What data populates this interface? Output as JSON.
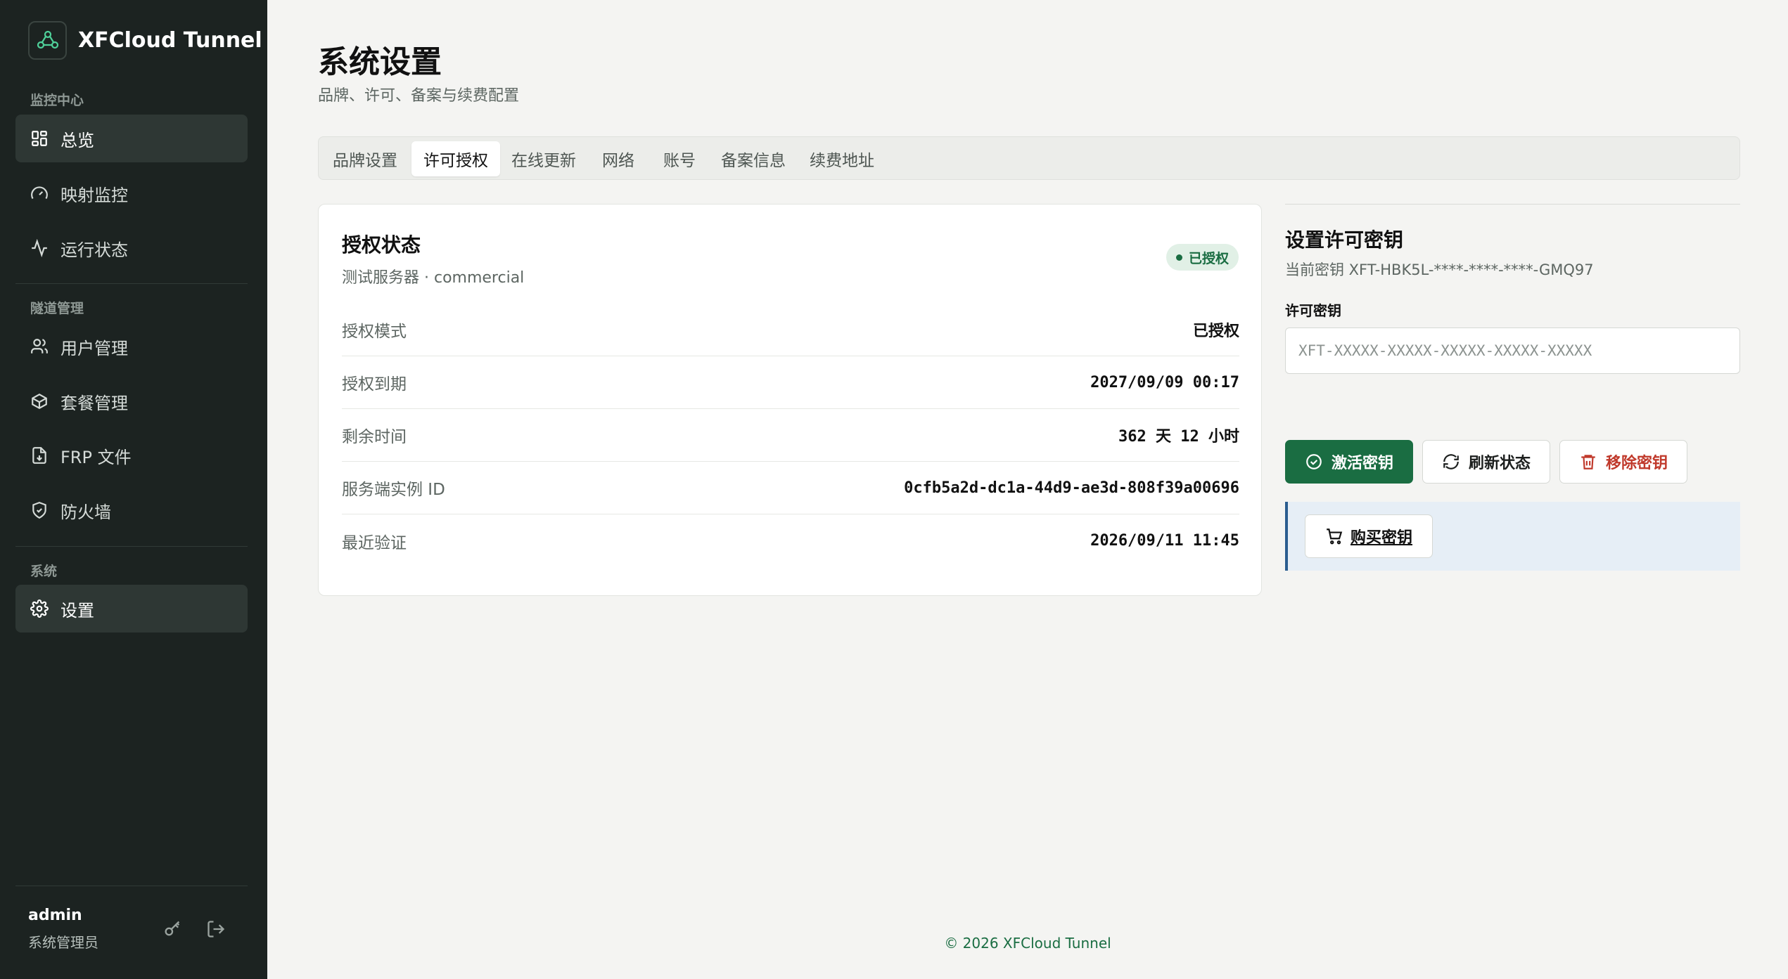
{
  "app": {
    "name": "XFCloud Tunnel"
  },
  "sidebar": {
    "sections": [
      {
        "title": "监控中心",
        "items": [
          {
            "label": "总览",
            "icon": "grid-icon",
            "active": true
          },
          {
            "label": "映射监控",
            "icon": "gauge-icon"
          },
          {
            "label": "运行状态",
            "icon": "activity-icon"
          }
        ]
      },
      {
        "title": "隧道管理",
        "items": [
          {
            "label": "用户管理",
            "icon": "users-icon"
          },
          {
            "label": "套餐管理",
            "icon": "package-icon"
          },
          {
            "label": "FRP 文件",
            "icon": "file-download-icon"
          },
          {
            "label": "防火墙",
            "icon": "shield-icon"
          }
        ]
      },
      {
        "title": "系统",
        "items": [
          {
            "label": "设置",
            "icon": "gear-icon",
            "active": true
          }
        ]
      }
    ],
    "user": {
      "name": "admin",
      "role": "系统管理员"
    }
  },
  "page": {
    "title": "系统设置",
    "subtitle": "品牌、许可、备案与续费配置"
  },
  "tabs": [
    "品牌设置",
    "许可授权",
    "在线更新",
    "网络",
    "账号",
    "备案信息",
    "续费地址"
  ],
  "active_tab": "许可授权",
  "license": {
    "title": "授权状态",
    "subtitle": "测试服务器 · commercial",
    "badge": "已授权",
    "rows": [
      {
        "key": "授权模式",
        "value": "已授权"
      },
      {
        "key": "授权到期",
        "value": "2027/09/09 00:17"
      },
      {
        "key": "剩余时间",
        "value": "362 天 12 小时"
      },
      {
        "key": "服务端实例 ID",
        "value": "0cfb5a2d-dc1a-44d9-ae3d-808f39a00696"
      },
      {
        "key": "最近验证",
        "value": "2026/09/11 11:45"
      }
    ]
  },
  "key_panel": {
    "title": "设置许可密钥",
    "current": "当前密钥 XFT-HBK5L-****-****-****-GMQ97",
    "field_label": "许可密钥",
    "placeholder": "XFT-XXXXX-XXXXX-XXXXX-XXXXX-XXXXX",
    "value": "",
    "activate": "激活密钥",
    "refresh": "刷新状态",
    "remove": "移除密钥",
    "buy": "购买密钥"
  },
  "footer": "© 2026 XFCloud Tunnel",
  "colors": {
    "sidebar_bg": "#1c2321",
    "accent": "#1a6d42",
    "danger": "#c0392b",
    "info_bg": "#e6eef6"
  }
}
